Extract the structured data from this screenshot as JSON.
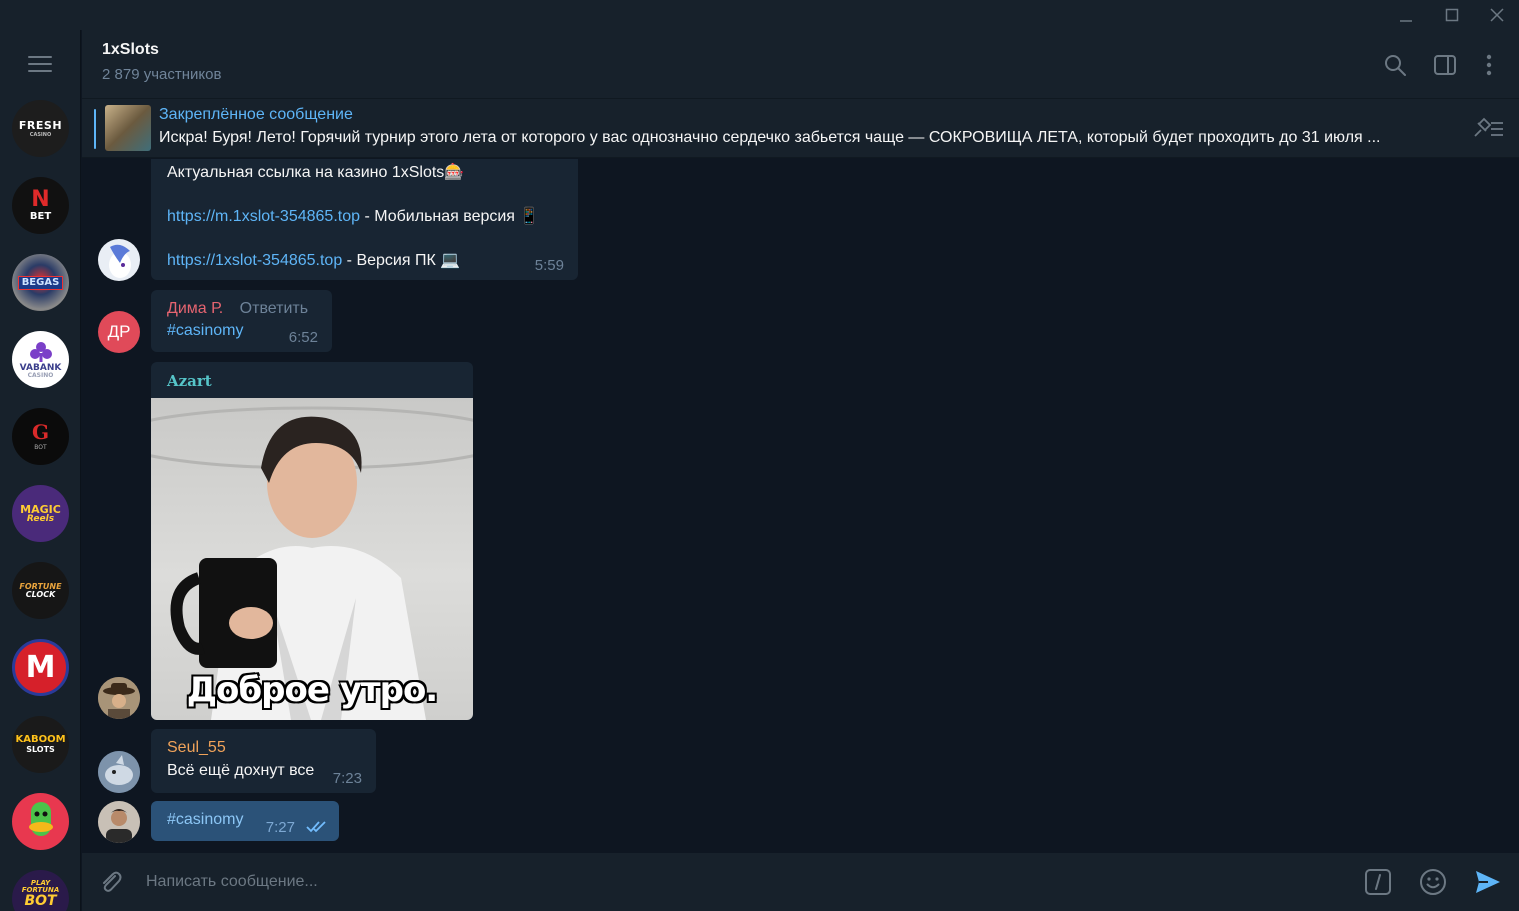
{
  "window": {
    "minimize": "minimize",
    "maximize": "maximize",
    "close": "close"
  },
  "header": {
    "title": "1xSlots",
    "subtitle": "2 879 участников"
  },
  "rail": {
    "chats": [
      {
        "name": "fresh",
        "label": "FRESH",
        "sub": "CASINO",
        "color": "#1d1d1d"
      },
      {
        "name": "nbet",
        "label": "N",
        "sub": "BET",
        "color": "#111111"
      },
      {
        "name": "begas",
        "label": "BEGAS",
        "sub": "",
        "color": "#2a3b66"
      },
      {
        "name": "vabank",
        "label": "VABANK",
        "sub": "CASINO",
        "color": "#ffffff"
      },
      {
        "name": "g-bot",
        "label": "G",
        "sub": "BOT",
        "color": "#0b0b0b"
      },
      {
        "name": "magic-reels",
        "label": "MAGIC",
        "sub": "Reels",
        "color": "#4a2a7a"
      },
      {
        "name": "fortune-clock",
        "label": "FORTUNE",
        "sub": "CLOCK",
        "color": "#161616"
      },
      {
        "name": "m-casino",
        "label": "M",
        "sub": "",
        "color": "#d6202a"
      },
      {
        "name": "kaboom-slots",
        "label": "KABOOM",
        "sub": "SLOTS",
        "color": "#1a1a1a"
      },
      {
        "name": "duck",
        "label": "",
        "sub": "",
        "color": "#e8384f"
      },
      {
        "name": "play-fortuna-bot",
        "label": "PLAY FORTUNA",
        "sub": "BOT",
        "color": "#2a1a4a"
      }
    ]
  },
  "pinned": {
    "title": "Закреплённое сообщение",
    "text": "Искра! Буря! Лето!   Горячий турнир этого лета от которого у вас однозначно сердечко забьется чаще — СОКРОВИЩА ЛЕТА, который будет проходить до 31 июля ..."
  },
  "messages": {
    "m1": {
      "line1": "Актуальная ссылка на казино 1xSlots🎰",
      "link1": "https://m.1xslot-354865.top",
      "desc1": " - Мобильная версия 📱",
      "link2": "https://1xslot-354865.top",
      "desc2": " - Версия ПК 💻",
      "time": "5:59"
    },
    "m2": {
      "initials": "ДР",
      "author": "Дима Р.",
      "reply": "Ответить",
      "text": "#casinomy",
      "time": "6:52"
    },
    "m3": {
      "author": "Azart",
      "caption": "Доброе утро."
    },
    "m4": {
      "author": "Seul_55",
      "text": "Всё ещё дохнут все",
      "time": "7:23"
    },
    "m5": {
      "text": "#casinomy",
      "time": "7:27"
    }
  },
  "composer": {
    "placeholder": "Написать сообщение..."
  },
  "colors": {
    "accent": "#5eb5f7",
    "bg": "#0e1621",
    "panel": "#17212b",
    "bubble_in": "#182533",
    "bubble_out": "#2b5278"
  }
}
